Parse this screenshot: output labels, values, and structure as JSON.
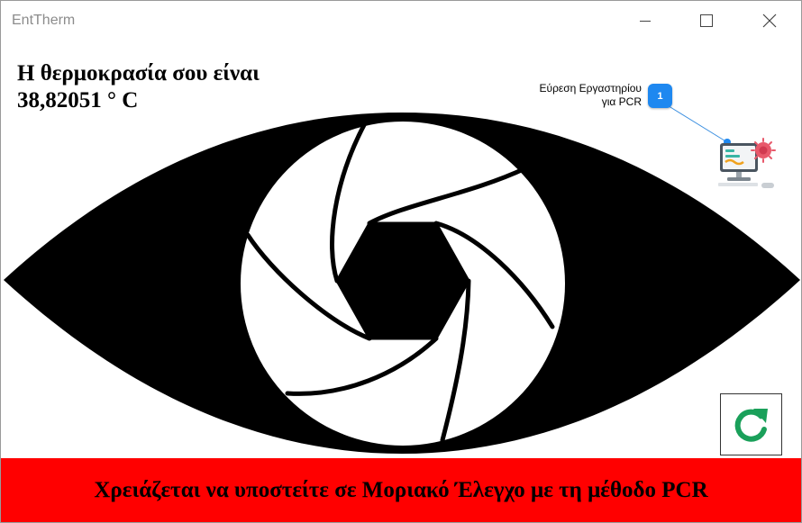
{
  "window": {
    "title": "EntTherm",
    "minimize_icon": "minimize-icon",
    "maximize_icon": "maximize-icon",
    "close_icon": "close-icon"
  },
  "temperature": {
    "line1": "Η θερμοκρασία σου είναι",
    "line2": "38,82051 ° C"
  },
  "lab_finder": {
    "label_line1": "Εύρεση  Εργαστηρίου",
    "label_line2": "για PCR",
    "badge": "1",
    "badge_color": "#1e88f0",
    "icon": "lab-computer-virus-icon"
  },
  "refresh": {
    "icon": "refresh-icon",
    "color": "#1aa05a"
  },
  "banner": {
    "text": "Χρειάζεται να υποστείτε σε Μοριακό Έλεγχο με τη μέθοδο PCR",
    "background": "#ff0000"
  },
  "illustration": {
    "icon": "eye-aperture-icon"
  }
}
